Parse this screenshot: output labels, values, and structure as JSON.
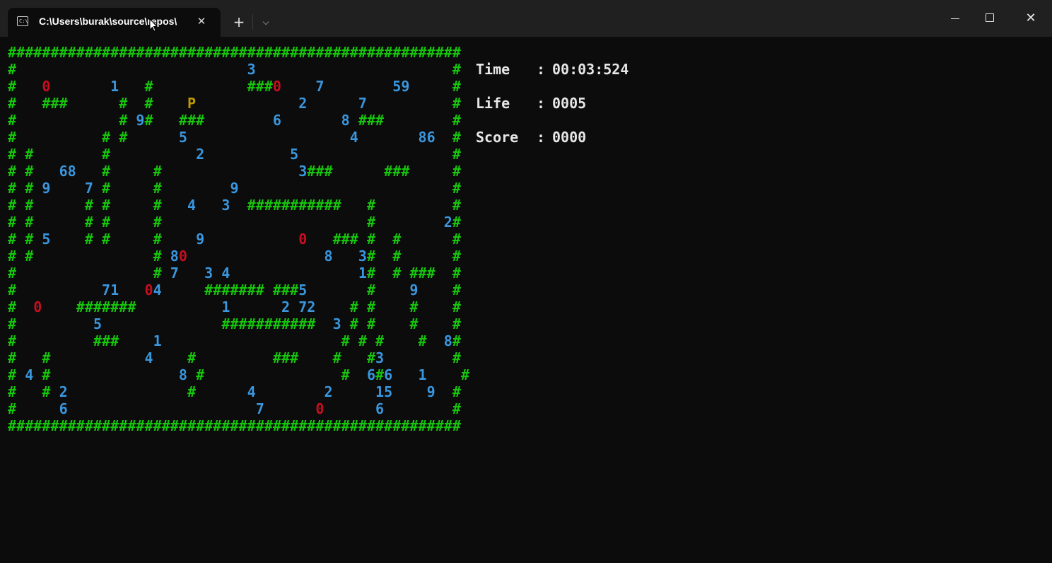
{
  "window": {
    "tab_title": "C:\\Users\\burak\\source\\repos\\",
    "tab_icon_text": "C:\\",
    "close_tab_glyph": "✕",
    "new_tab_glyph": "+",
    "dropdown_glyph": "⌵",
    "close_window_glyph": "✕"
  },
  "map": {
    "colors": {
      "wall": "#16c60c",
      "number": "#3a96dd",
      "zero": "#c50f1f",
      "player": "#c19c00",
      "background": "#0c0c0c"
    },
    "rows": [
      "#####################################################",
      "#                           3                       #",
      "#   0       1   #           ###0    7        59     #",
      "#   ###      #  #    P            2      7          #",
      "#            # 9#   ###        6       8 ###        #",
      "#          # #      5                   4       86  #",
      "# #        #          2          5                  #",
      "# #   68   #     #                3###      ###     #",
      "# # 9    7 #     #        9                         #",
      "# #      # #     #   4   3  ###########   #         #",
      "# #      # #     #                        #        2#",
      "# # 5    # #     #    9           0   ### #  #      #",
      "# #              # 80                8   3#  #      #",
      "#                # 7   3 4               1#  # ###  #",
      "#          71   04     ####### ###5       #    9    #",
      "#  0    #######          1      2 72    # #    #    #",
      "#         5              ###########  3 # #    #    #",
      "#         ###    1                     # # #    #  8#",
      "#   #           4    #         ###    #   #3        #",
      "# 4 #               8 #                #  6#6   1    #",
      "#   # 2              #      4        2     15    9  #",
      "#     6                      7      0      6        #",
      "#####################################################"
    ]
  },
  "stats": {
    "time_label": "Time",
    "time_value": "00:03:524",
    "life_label": "Life",
    "life_value": "0005",
    "score_label": "Score",
    "score_value": "0000",
    "separator": ":"
  }
}
